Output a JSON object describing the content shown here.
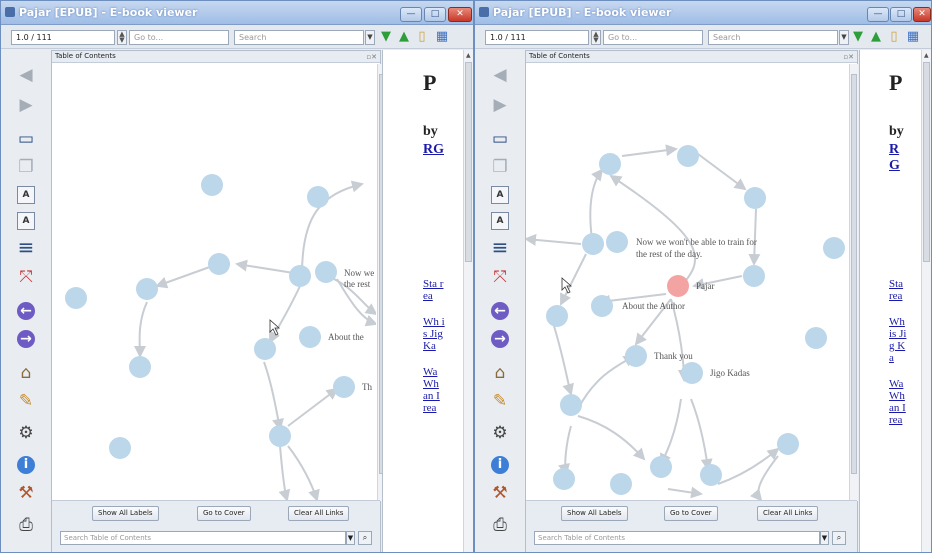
{
  "windows": [
    {
      "title": "Pajar [EPUB] - E-book viewer",
      "toolbar": {
        "position": "1.0 / 111",
        "goto_placeholder": "Go to...",
        "search_placeholder": "Search"
      },
      "toc": {
        "header": "Table of Contents",
        "buttons": {
          "show_labels": "Show All Labels",
          "go_to_cover": "Go to Cover",
          "clear_links": "Clear All Links"
        },
        "search_placeholder": "Search Table of Contents",
        "node_labels": [
          "Now we",
          "the rest",
          "About the",
          "Th"
        ]
      },
      "book": {
        "title": "P",
        "by": "by",
        "author": "RG",
        "links": [
          "Sta rea",
          "Wh is Jig Ka",
          "Wa Wh an I rea"
        ]
      }
    },
    {
      "title": "Pajar [EPUB] - E-book viewer",
      "toolbar": {
        "position": "1.0 / 111",
        "goto_placeholder": "Go to...",
        "search_placeholder": "Search"
      },
      "toc": {
        "header": "Table of Contents",
        "buttons": {
          "show_labels": "Show All Labels",
          "go_to_cover": "Go to Cover",
          "clear_links": "Clear All Links"
        },
        "search_placeholder": "Search Table of Contents",
        "node_labels": [
          "Now we won't be able to train for",
          "the rest of the day.",
          "Pajar",
          "About the Author",
          "Thank you",
          "Jigo Kadas"
        ]
      },
      "book": {
        "title": "P",
        "by": "by",
        "author": "RG",
        "links": [
          "Sta rea",
          "Wh is Jig Ka",
          "Wa Wh an I rea"
        ]
      }
    }
  ],
  "colors": {
    "node": "#bcd6ea",
    "node_active": "#f4a3a3",
    "edge": "#c8cdd3",
    "link": "#1a1aaa"
  },
  "icons": [
    "back-arrow-icon",
    "forward-arrow-icon",
    "print-preview-icon",
    "copy-icon",
    "font-larger-icon",
    "font-smaller-icon",
    "toc-list-icon",
    "fullscreen-icon",
    "previous-chapter-icon",
    "next-chapter-icon",
    "library-icon",
    "reference-mode-icon",
    "preferences-gear-icon",
    "info-icon",
    "tools-icon",
    "print-icon"
  ]
}
